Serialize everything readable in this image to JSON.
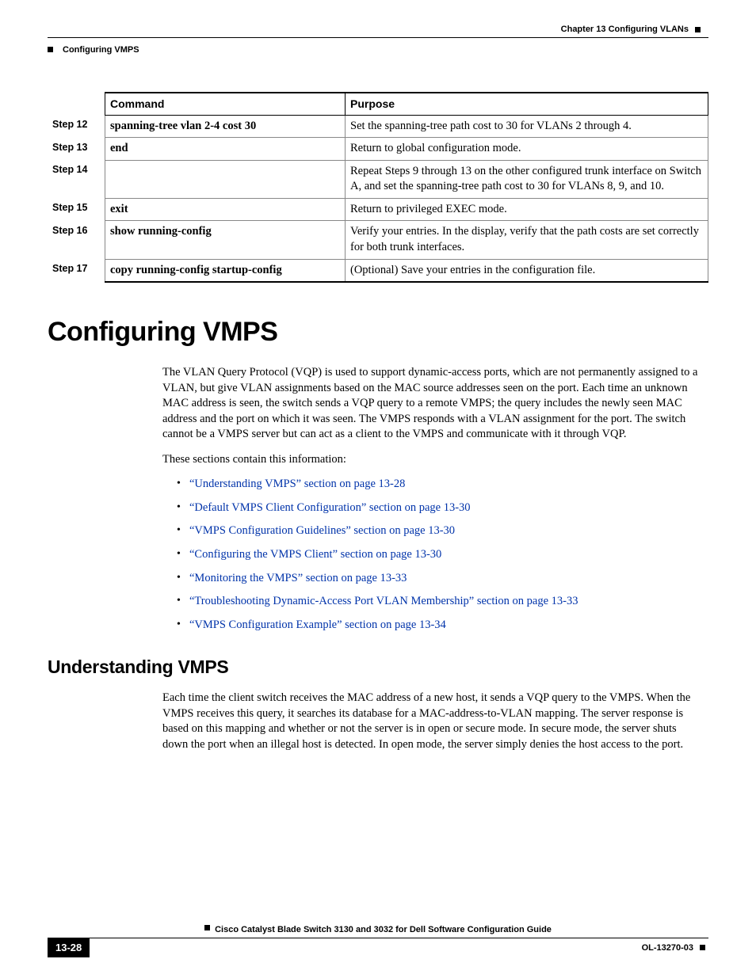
{
  "header": {
    "chapter": "Chapter 13    Configuring VLANs",
    "section": "Configuring VMPS"
  },
  "table": {
    "head_command": "Command",
    "head_purpose": "Purpose",
    "rows": [
      {
        "step": "Step 12",
        "command": "spanning-tree vlan 2-4 cost 30",
        "purpose": "Set the spanning-tree path cost to 30 for VLANs 2 through 4."
      },
      {
        "step": "Step 13",
        "command": "end",
        "purpose": "Return to global configuration mode."
      },
      {
        "step": "Step 14",
        "command": "",
        "purpose": "Repeat Steps 9 through 13 on the other configured trunk interface on Switch A, and set the spanning-tree path cost to 30 for VLANs 8, 9, and 10."
      },
      {
        "step": "Step 15",
        "command": "exit",
        "purpose": "Return to privileged EXEC mode."
      },
      {
        "step": "Step 16",
        "command": "show running-config",
        "purpose": "Verify your entries. In the display, verify that the path costs are set correctly for both trunk interfaces."
      },
      {
        "step": "Step 17",
        "command": "copy running-config startup-config",
        "purpose": "(Optional) Save your entries in the configuration file."
      }
    ]
  },
  "h1": "Configuring VMPS",
  "intro_p1": "The VLAN Query Protocol (VQP) is used to support dynamic-access ports, which are not permanently assigned to a VLAN, but give VLAN assignments based on the MAC source addresses seen on the port. Each time an unknown MAC address is seen, the switch sends a VQP query to a remote VMPS; the query includes the newly seen MAC address and the port on which it was seen. The VMPS responds with a VLAN assignment for the port. The switch cannot be a VMPS server but can act as a client to the VMPS and communicate with it through VQP.",
  "intro_p2": "These sections contain this information:",
  "links": [
    "“Understanding VMPS” section on page 13-28",
    "“Default VMPS Client Configuration” section on page 13-30",
    "“VMPS Configuration Guidelines” section on page 13-30",
    "“Configuring the VMPS Client” section on page 13-30",
    "“Monitoring the VMPS” section on page 13-33",
    "“Troubleshooting Dynamic-Access Port VLAN Membership” section on page 13-33",
    "“VMPS Configuration Example” section on page 13-34"
  ],
  "h2": "Understanding VMPS",
  "understanding_p1": "Each time the client switch receives the MAC address of a new host, it sends a VQP query to the VMPS. When the VMPS receives this query, it searches its database for a MAC-address-to-VLAN mapping. The server response is based on this mapping and whether or not the server is in open or secure mode. In secure mode, the server shuts down the port when an illegal host is detected. In open mode, the server simply denies the host access to the port.",
  "footer": {
    "title": "Cisco Catalyst Blade Switch 3130 and 3032 for Dell Software Configuration Guide",
    "page": "13-28",
    "doc": "OL-13270-03"
  }
}
